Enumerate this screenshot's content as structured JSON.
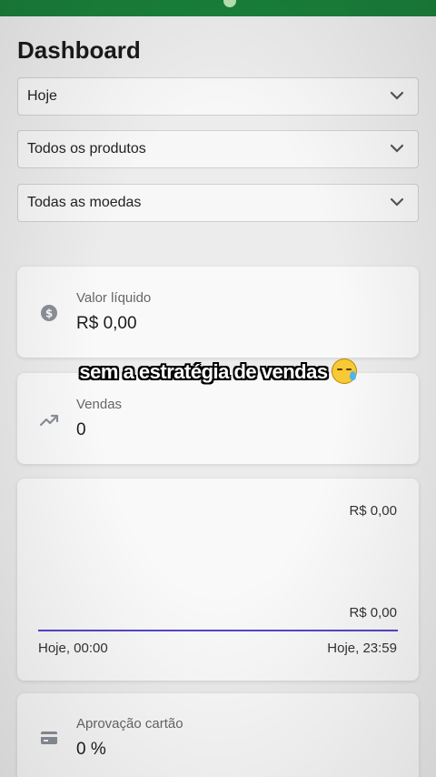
{
  "page": {
    "title": "Dashboard"
  },
  "filters": {
    "period": "Hoje",
    "products": "Todos os produtos",
    "currencies": "Todas as moedas"
  },
  "cards": {
    "net_value": {
      "label": "Valor líquido",
      "value": "R$ 0,00",
      "icon": "dollar-coin-icon"
    },
    "sales": {
      "label": "Vendas",
      "value": "0",
      "icon": "trending-up-icon"
    },
    "card_approval": {
      "label": "Aprovação cartão",
      "value": "0 %",
      "icon": "credit-card-icon"
    }
  },
  "chart": {
    "y_top": "R$ 0,00",
    "y_bottom": "R$ 0,00",
    "x_start": "Hoje, 00:00",
    "x_end": "Hoje, 23:59",
    "line_color": "#5346c9"
  },
  "overlay_caption": "sem a estratégia de vendas",
  "colors": {
    "topbar": "#1a7f3a",
    "accent": "#5346c9"
  }
}
